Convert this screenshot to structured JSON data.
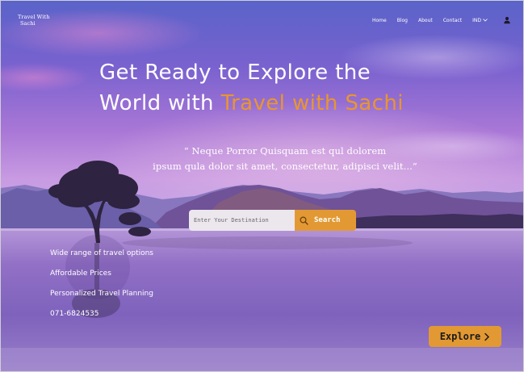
{
  "brand": {
    "line1": "Travel With",
    "line2": "Sachi"
  },
  "nav": {
    "items": [
      "Home",
      "Blog",
      "About",
      "Contact"
    ],
    "language": "IND"
  },
  "hero": {
    "title_line1": "Get Ready to Explore the",
    "title_line2_prefix": "World with ",
    "title_line2_highlight": "Travel with Sachi",
    "quote_line1": "“  Neque Porror Quisquam est qul dolorem",
    "quote_line2": "ipsum qula dolor sit amet, consectetur, adipisci velit...”"
  },
  "search": {
    "placeholder": "Enter Your Destination",
    "button_label": "Search"
  },
  "features": [
    "Wide range of travel options",
    "Affordable Prices",
    "Personalized Travel Planning",
    "071-6824535"
  ],
  "explore": {
    "label": "Explore"
  },
  "colors": {
    "accent": "#e29933",
    "headline_highlight": "#e8962f",
    "text": "#ffffff"
  },
  "icons": {
    "search": "search-icon",
    "chevron_down": "chevron-down-icon",
    "user": "user-icon",
    "explore_arrow": "chevron-right-icon"
  }
}
